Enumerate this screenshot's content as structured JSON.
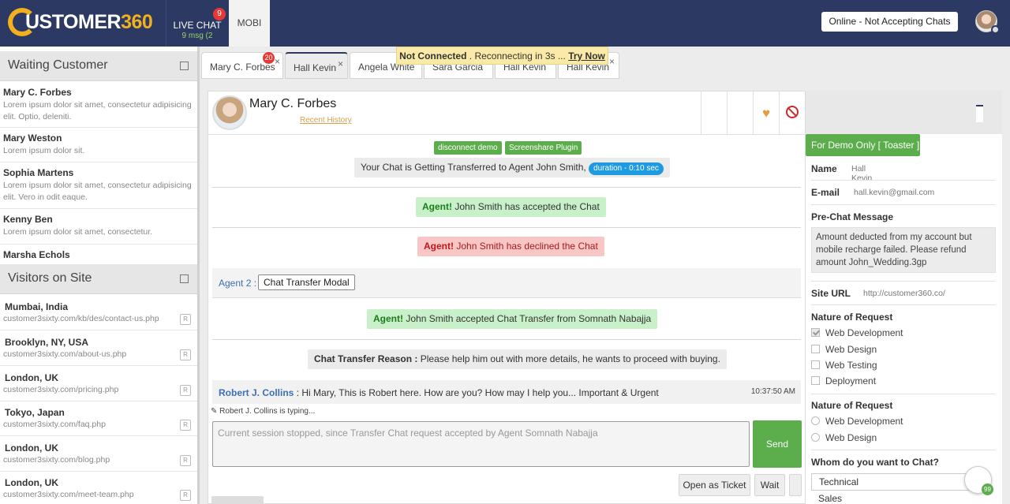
{
  "topbar": {
    "logo_prefix": "USTOMER",
    "logo_number": "360",
    "live_chat_label": "LIVE CHAT",
    "live_chat_badge": "9",
    "live_chat_sub": "9 msg (2",
    "mobi_label": "MOBI",
    "status_button": "Online - Not Accepting Chats"
  },
  "waiting": {
    "title": "Waiting Customer",
    "items": [
      {
        "name": "Mary C. Forbes",
        "desc": "Lorem ipsum dolor sit amet, consectetur adipisicing elit. Optio, deleniti."
      },
      {
        "name": "Mary Weston",
        "desc": "Lorem ipsum dolor sit."
      },
      {
        "name": "Sophia Martens",
        "desc": "Lorem ipsum dolor sit amet, consectetur adipisicing elit. Vero in odit eaque."
      },
      {
        "name": "Kenny Ben",
        "desc": "Lorem ipsum dolor sit amet, consectetur."
      },
      {
        "name": "Marsha Echols",
        "desc": ""
      }
    ]
  },
  "visitors": {
    "title": "Visitors on Site",
    "badge": "R",
    "items": [
      {
        "place": "Mumbai, India",
        "url": "customer3sixty.com/kb/des/contact-us.php"
      },
      {
        "place": "Brooklyn, NY, USA",
        "url": "customer3sixty.com/about-us.php"
      },
      {
        "place": "London, UK",
        "url": "customer3sixty.com/pricing.php"
      },
      {
        "place": "Tokyo, Japan",
        "url": "customer3sixty.com/faq.php"
      },
      {
        "place": "London, UK",
        "url": "customer3sixty.com/blog.php"
      },
      {
        "place": "London, UK",
        "url": "customer3sixty.com/meet-team.php"
      }
    ]
  },
  "chat_tabs": [
    {
      "label": "Mary C. Forbes",
      "badge": "20"
    },
    {
      "label": "Hall Kevin"
    },
    {
      "label": "Angela White"
    },
    {
      "label": "Sara Garcia"
    },
    {
      "label": "Hall Kevin"
    },
    {
      "label": "Hall Kevin"
    }
  ],
  "close_glyph": "×",
  "reconnect": {
    "bold": "Not Connected",
    "text": ". Reconnecting in 3s ...",
    "link": "Try Now"
  },
  "chat": {
    "customer_name": "Mary C. Forbes",
    "recent_history": "Recent History",
    "btn_disconnect": "disconnect demo",
    "btn_screenshare": "Screenshare Plugin",
    "transfer_text": "Your Chat is Getting Transferred to Agent John Smith,",
    "duration": "duration - 0:10 sec",
    "accepted_prefix": "Agent!",
    "accepted_text": "John Smith has accepted the Chat",
    "declined_prefix": "Agent!",
    "declined_text": "John Smith has declined the Chat",
    "agent2_label": "Agent 2 :",
    "agent2_modal": "Chat Transfer Modal",
    "transfer_acc_prefix": "Agent!",
    "transfer_acc_text": "John Smith accepted Chat Transfer from Somnath Nabajja",
    "reason_label": "Chat Transfer Reason :",
    "reason_text": "Please help him out with more details, he wants to proceed with buying.",
    "msg_author": "Robert J. Collins",
    "msg_text": ": Hi Mary, This is Robert here. How are you? How may I help you... Important & Urgent",
    "msg_time": "10:37:50 AM",
    "typing": "Robert J. Collins is typing...",
    "input_placeholder": "Current session stopped, since Transfer Chat request accepted by Agent Somnath Nabajja",
    "send": "Send",
    "open_ticket": "Open as Ticket",
    "wait": "Wait"
  },
  "details": {
    "demo_toast": "For Demo Only [ Toaster ]",
    "name_label": "Name",
    "name_value": "Hall Kevin",
    "email_label": "E-mail",
    "email_value": "hall.kevin@gmail.com",
    "prechat_label": "Pre-Chat Message",
    "prechat_value": "Amount deducted from my account but mobile recharge failed. Please refund amount John_Wedding.3gp",
    "site_label": "Site URL",
    "site_value": "http://customer360.co/",
    "nature_label": "Nature of Request",
    "nature_options": [
      {
        "label": "Web Development",
        "checked": true
      },
      {
        "label": "Web Design",
        "checked": false
      },
      {
        "label": "Web Testing",
        "checked": false
      },
      {
        "label": "Deployment",
        "checked": false
      }
    ],
    "nature2_label": "Nature of Request",
    "nature2_options": [
      "Web Development",
      "Web Design"
    ],
    "whom_label": "Whom do you want to Chat?",
    "whom_selected": "Technical",
    "whom_next": "Sales"
  },
  "fab_count": "99"
}
